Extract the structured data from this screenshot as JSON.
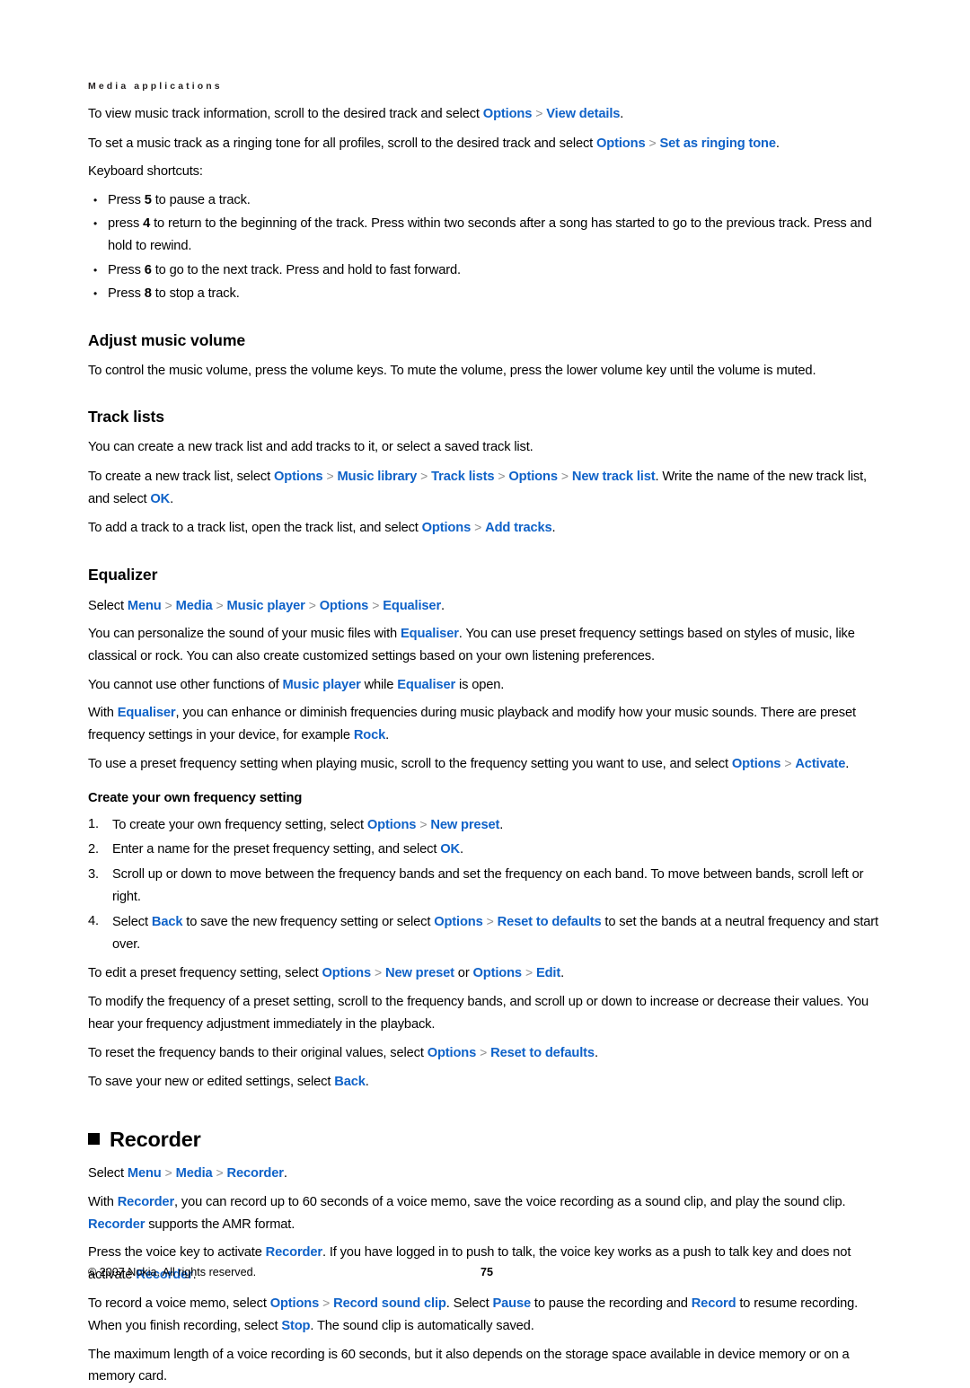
{
  "running_head": "Media applications",
  "colors": {
    "link": "#0f62c8",
    "separator": "#8d8d8d",
    "text": "#000000"
  },
  "separator_glyph": ">",
  "intro": {
    "p1_a": "To view music track information, scroll to the desired track and select ",
    "p1_link1": "Options",
    "p1_link2": "View details",
    "p1_end": ".",
    "p2_a": "To set a music track as a ringing tone for all profiles, scroll to the desired track and select ",
    "p2_link1": "Options",
    "p2_link2": "Set as ringing tone",
    "p2_end": ".",
    "p3": "Keyboard shortcuts:"
  },
  "shortcuts": [
    {
      "pre": "Press ",
      "key": "5",
      "post": " to pause a track."
    },
    {
      "pre": "press ",
      "key": "4",
      "post": " to return to the beginning of the track. Press within two seconds after a song has started to go to the previous track. Press and hold to rewind."
    },
    {
      "pre": "Press ",
      "key": "6",
      "post": " to go to the next track. Press and hold to fast forward."
    },
    {
      "pre": "Press ",
      "key": "8",
      "post": " to stop a track."
    }
  ],
  "volume": {
    "heading": "Adjust music volume",
    "body": "To control the music volume, press the volume keys. To mute the volume, press the lower volume key until the volume is muted."
  },
  "track_lists": {
    "heading": "Track lists",
    "p1": "You can create a new track list and add tracks to it, or select a saved track list.",
    "p2_a": "To create a new track list, select ",
    "p2_l1": "Options",
    "p2_l2": "Music library",
    "p2_l3": "Track lists",
    "p2_l4": "Options",
    "p2_l5": "New track list",
    "p2_mid": ". Write the name of the new track list, and select ",
    "p2_l6": "OK",
    "p2_end": ".",
    "p3_a": "To add a track to a track list, open the track list, and select ",
    "p3_l1": "Options",
    "p3_l2": "Add tracks",
    "p3_end": "."
  },
  "equalizer": {
    "heading": "Equalizer",
    "path_a": "Select ",
    "path_l1": "Menu",
    "path_l2": "Media",
    "path_l3": "Music player",
    "path_l4": "Options",
    "path_l5": "Equaliser",
    "path_end": ".",
    "p1_a": "You can personalize the sound of your music files with ",
    "p1_l1": "Equaliser",
    "p1_b": ". You can use preset frequency settings based on styles of music, like classical or rock. You can also create customized settings based on your own listening preferences.",
    "p2_a": "You cannot use other functions of ",
    "p2_l1": "Music player",
    "p2_b": " while ",
    "p2_l2": "Equaliser",
    "p2_c": " is open.",
    "p3_a": "With ",
    "p3_l1": "Equaliser",
    "p3_b": ", you can enhance or diminish frequencies during music playback and modify how your music sounds. There are preset frequency settings in your device, for example ",
    "p3_l2": "Rock",
    "p3_c": ".",
    "p4_a": "To use a preset frequency setting when playing music, scroll to the frequency setting you want to use, and select ",
    "p4_l1": "Options",
    "p4_l2": "Activate",
    "p4_end": ".",
    "subheading": "Create your own frequency setting",
    "steps": [
      {
        "a": "To create your own frequency setting, select ",
        "l1": "Options",
        "l2": "New preset",
        "b": "."
      },
      {
        "a": "Enter a name for the preset frequency setting, and select ",
        "l1": "OK",
        "b": "."
      },
      {
        "a": "Scroll up or down to move between the frequency bands and set the frequency on each band. To move between bands, scroll left or right."
      },
      {
        "a": "Select ",
        "l1": "Back",
        "b": " to save the new frequency setting or select ",
        "l2": "Options",
        "l3": "Reset to defaults",
        "c": " to set the bands at a neutral frequency and start over."
      }
    ],
    "p5_a": "To edit a preset frequency setting, select ",
    "p5_l1": "Options",
    "p5_l2": "New preset",
    "p5_b": " or ",
    "p5_l3": "Options",
    "p5_l4": "Edit",
    "p5_c": ".",
    "p6": "To modify the frequency of a preset setting, scroll to the frequency bands, and scroll up or down to increase or decrease their values. You hear your frequency adjustment immediately in the playback.",
    "p7_a": "To reset the frequency bands to their original values, select ",
    "p7_l1": "Options",
    "p7_l2": "Reset to defaults",
    "p7_b": ".",
    "p8_a": "To save your new or edited settings, select ",
    "p8_l1": "Back",
    "p8_b": "."
  },
  "recorder": {
    "heading": "Recorder",
    "path_a": "Select ",
    "path_l1": "Menu",
    "path_l2": "Media",
    "path_l3": "Recorder",
    "path_end": ".",
    "p1_a": "With ",
    "p1_l1": "Recorder",
    "p1_b": ", you can record up to 60 seconds of a voice memo, save the voice recording as a sound clip, and play the sound clip. ",
    "p1_l2": "Recorder",
    "p1_c": " supports the AMR format.",
    "p2_a": "Press the voice key to activate ",
    "p2_l1": "Recorder",
    "p2_b": ". If you have logged in to push to talk, the voice key works as a push to talk key and does not activate ",
    "p2_l2": "Recorder",
    "p2_c": ".",
    "p3_a": "To record a voice memo, select ",
    "p3_l1": "Options",
    "p3_l2": "Record sound clip",
    "p3_b": ". Select ",
    "p3_l3": "Pause",
    "p3_c": " to pause the recording and ",
    "p3_l4": "Record",
    "p3_d": " to resume recording. When you finish recording, select ",
    "p3_l5": "Stop",
    "p3_e": ". The sound clip is automatically saved.",
    "p4": "The maximum length of a voice recording is 60 seconds, but it also depends on the storage space available in device memory or on a memory card."
  },
  "footer": {
    "copyright": "© 2007 Nokia. All rights reserved.",
    "page_number": "75"
  }
}
